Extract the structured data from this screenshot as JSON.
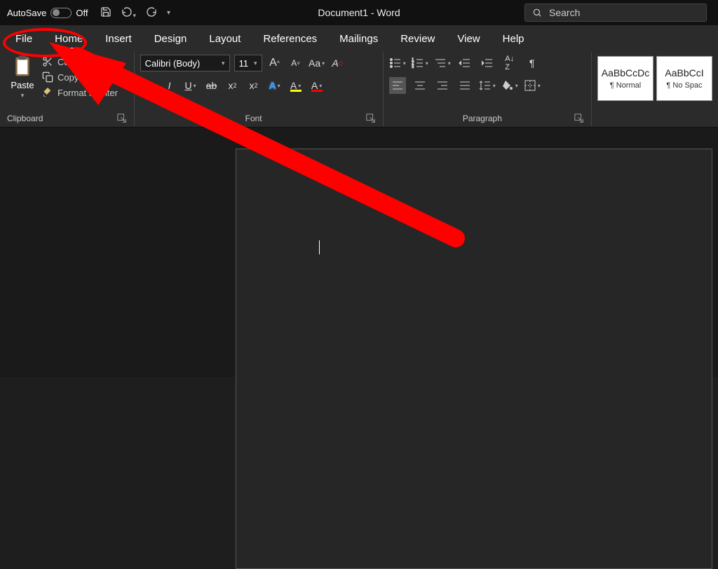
{
  "titlebar": {
    "autosave_label": "AutoSave",
    "autosave_state": "Off",
    "document_title": "Document1 - Word",
    "search_placeholder": "Search"
  },
  "tabs": [
    "File",
    "Home",
    "Insert",
    "Design",
    "Layout",
    "References",
    "Mailings",
    "Review",
    "View",
    "Help"
  ],
  "active_tab": "Home",
  "ribbon": {
    "clipboard": {
      "label": "Clipboard",
      "paste": "Paste",
      "cut": "Cut",
      "copy": "Copy",
      "format_painter": "Format Painter"
    },
    "font": {
      "label": "Font",
      "family": "Calibri (Body)",
      "size": "11"
    },
    "paragraph": {
      "label": "Paragraph"
    },
    "styles": {
      "items": [
        {
          "preview": "AaBbCcDc",
          "name": "¶ Normal"
        },
        {
          "preview": "AaBbCcI",
          "name": "¶ No Spac"
        }
      ]
    }
  },
  "annotation": {
    "target": "File tab",
    "color": "#ff0000"
  }
}
